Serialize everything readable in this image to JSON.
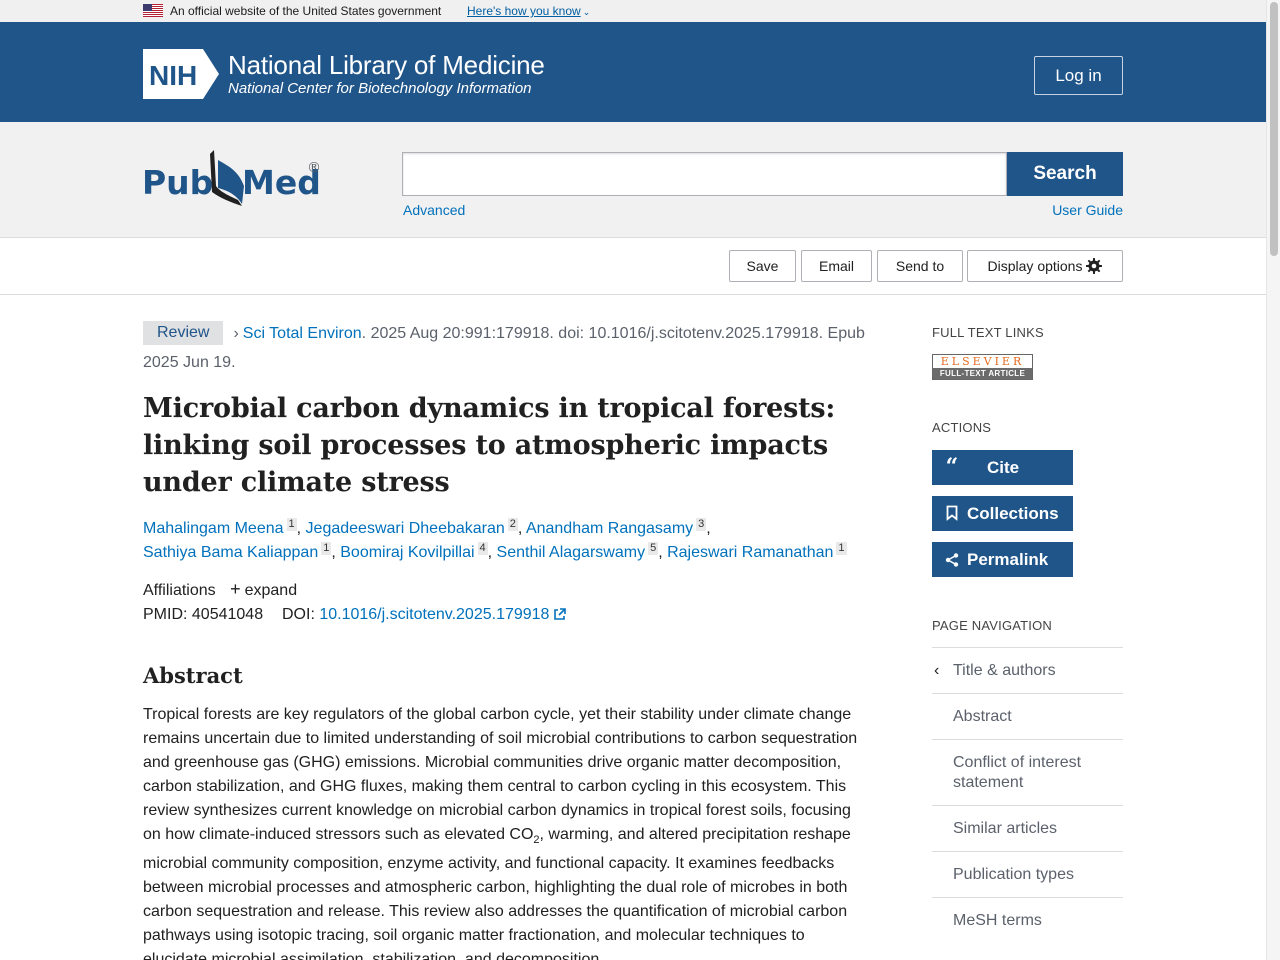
{
  "gov_banner": {
    "text": "An official website of the United States government",
    "link": "Here's how you know"
  },
  "header": {
    "org_abbrev": "NIH",
    "title": "National Library of Medicine",
    "subtitle": "National Center for Biotechnology Information",
    "login_label": "Log in"
  },
  "search": {
    "logo_text_left": "Pub",
    "logo_text_right": "Med",
    "logo_reg": "®",
    "query": "",
    "button_label": "Search",
    "advanced_label": "Advanced",
    "user_guide_label": "User Guide"
  },
  "toolbar": {
    "save_label": "Save",
    "email_label": "Email",
    "send_label": "Send to",
    "display_label": "Display options"
  },
  "article": {
    "badge": "Review",
    "journal": "Sci Total Environ",
    "citation": ". 2025 Aug 20:991:179918. doi: 10.1016/j.scitotenv.2025.179918.",
    "epub": "Epub 2025 Jun 19.",
    "title": "Microbial carbon dynamics in tropical forests: linking soil processes to atmospheric impacts under climate stress",
    "authors": [
      {
        "name": "Mahalingam Meena",
        "aff": "1"
      },
      {
        "name": "Jegadeeswari Dheebakaran",
        "aff": "2"
      },
      {
        "name": "Anandham Rangasamy",
        "aff": "3"
      },
      {
        "name": "Sathiya Bama Kaliappan",
        "aff": "1"
      },
      {
        "name": "Boomiraj Kovilpillai",
        "aff": "4"
      },
      {
        "name": "Senthil Alagarswamy",
        "aff": "5"
      },
      {
        "name": "Rajeswari Ramanathan",
        "aff": "1"
      }
    ],
    "affiliations_label": "Affiliations",
    "expand_label": "expand",
    "pmid_label": "PMID:",
    "pmid": "40541048",
    "doi_label": "DOI:",
    "doi": "10.1016/j.scitotenv.2025.179918",
    "abstract_heading": "Abstract",
    "abstract_part1": "Tropical forests are key regulators of the global carbon cycle, yet their stability under climate change remains uncertain due to limited understanding of soil microbial contributions to carbon sequestration and greenhouse gas (GHG) emissions. Microbial communities drive organic matter decomposition, carbon stabilization, and GHG fluxes, making them central to carbon cycling in this ecosystem. This review synthesizes current knowledge on microbial carbon dynamics in tropical forest soils, focusing on how climate-induced stressors such as elevated CO",
    "abstract_sub": "2",
    "abstract_part2": ", warming, and altered precipitation reshape microbial community composition, enzyme activity, and functional capacity. It examines feedbacks between microbial processes and atmospheric carbon, highlighting the dual role of microbes in both carbon sequestration and release. This review also addresses the quantification of microbial carbon pathways using isotopic tracing, soil organic matter fractionation, and molecular techniques to elucidate microbial assimilation, stabilization, and decomposition."
  },
  "sidebar": {
    "full_text_heading": "FULL TEXT LINKS",
    "elsevier_top": "ELSEVIER",
    "elsevier_bottom": "FULL-TEXT ARTICLE",
    "actions_heading": "ACTIONS",
    "cite_label": "Cite",
    "collections_label": "Collections",
    "permalink_label": "Permalink",
    "page_nav_heading": "PAGE NAVIGATION",
    "nav_items": [
      "Title & authors",
      "Abstract",
      "Conflict of interest statement",
      "Similar articles",
      "Publication types",
      "MeSH terms"
    ]
  },
  "colors": {
    "brand_blue": "#20558a",
    "link_blue": "#0071bc"
  }
}
